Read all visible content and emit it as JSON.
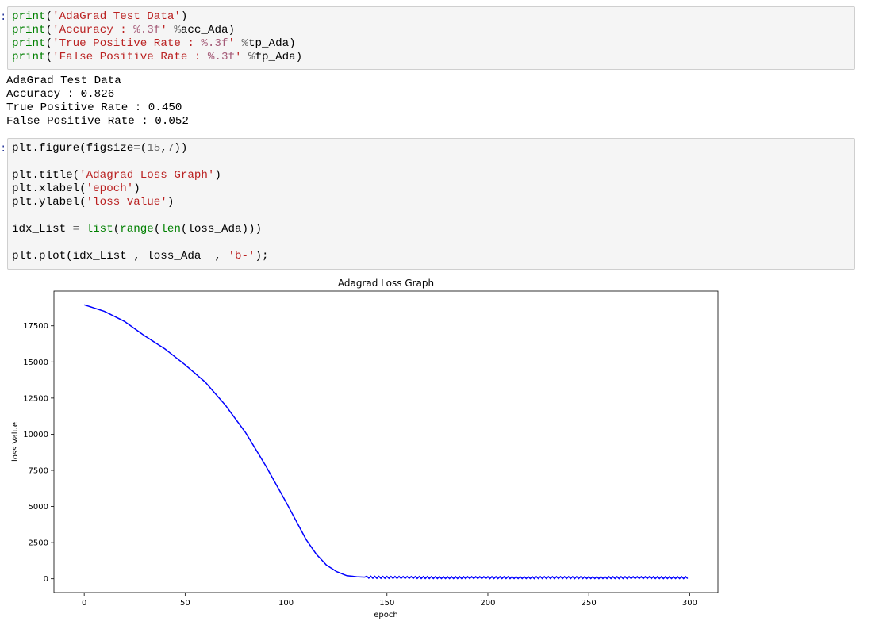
{
  "cell1": {
    "lines": [
      [
        {
          "t": "print",
          "c": "kw"
        },
        {
          "t": "(",
          "c": ""
        },
        {
          "t": "'AdaGrad Test Data'",
          "c": "str"
        },
        {
          "t": ")",
          "c": ""
        }
      ],
      [
        {
          "t": "print",
          "c": "kw"
        },
        {
          "t": "(",
          "c": ""
        },
        {
          "t": "'Accuracy : ",
          "c": "str"
        },
        {
          "t": "%.3f",
          "c": "fmt"
        },
        {
          "t": "'",
          "c": "str"
        },
        {
          "t": " ",
          "c": ""
        },
        {
          "t": "%",
          "c": "op"
        },
        {
          "t": "acc_Ada)",
          "c": ""
        }
      ],
      [
        {
          "t": "print",
          "c": "kw"
        },
        {
          "t": "(",
          "c": ""
        },
        {
          "t": "'True Positive Rate : ",
          "c": "str"
        },
        {
          "t": "%.3f",
          "c": "fmt"
        },
        {
          "t": "'",
          "c": "str"
        },
        {
          "t": " ",
          "c": ""
        },
        {
          "t": "%",
          "c": "op"
        },
        {
          "t": "tp_Ada)",
          "c": ""
        }
      ],
      [
        {
          "t": "print",
          "c": "kw"
        },
        {
          "t": "(",
          "c": ""
        },
        {
          "t": "'False Positive Rate : ",
          "c": "str"
        },
        {
          "t": "%.3f",
          "c": "fmt"
        },
        {
          "t": "'",
          "c": "str"
        },
        {
          "t": " ",
          "c": ""
        },
        {
          "t": "%",
          "c": "op"
        },
        {
          "t": "fp_Ada)",
          "c": ""
        }
      ]
    ]
  },
  "output1": {
    "lines": [
      "AdaGrad Test Data",
      "Accuracy : 0.826",
      "True Positive Rate : 0.450",
      "False Positive Rate : 0.052"
    ]
  },
  "cell2": {
    "lines": [
      [
        {
          "t": "plt.figure(figsize",
          "c": ""
        },
        {
          "t": "=",
          "c": "op"
        },
        {
          "t": "(",
          "c": ""
        },
        {
          "t": "15",
          "c": "num"
        },
        {
          "t": ",",
          "c": ""
        },
        {
          "t": "7",
          "c": "num"
        },
        {
          "t": "))",
          "c": ""
        }
      ],
      [],
      [
        {
          "t": "plt.title(",
          "c": ""
        },
        {
          "t": "'Adagrad Loss Graph'",
          "c": "str"
        },
        {
          "t": ")",
          "c": ""
        }
      ],
      [
        {
          "t": "plt.xlabel(",
          "c": ""
        },
        {
          "t": "'epoch'",
          "c": "str"
        },
        {
          "t": ")",
          "c": ""
        }
      ],
      [
        {
          "t": "plt.ylabel(",
          "c": ""
        },
        {
          "t": "'loss Value'",
          "c": "str"
        },
        {
          "t": ")",
          "c": ""
        }
      ],
      [],
      [
        {
          "t": "idx_List ",
          "c": ""
        },
        {
          "t": "=",
          "c": "op"
        },
        {
          "t": " ",
          "c": ""
        },
        {
          "t": "list",
          "c": "kw"
        },
        {
          "t": "(",
          "c": ""
        },
        {
          "t": "range",
          "c": "kw"
        },
        {
          "t": "(",
          "c": ""
        },
        {
          "t": "len",
          "c": "kw"
        },
        {
          "t": "(loss_Ada)))",
          "c": ""
        }
      ],
      [],
      [
        {
          "t": "plt.plot(idx_List , loss_Ada  , ",
          "c": ""
        },
        {
          "t": "'b-'",
          "c": "str"
        },
        {
          "t": ");",
          "c": ""
        }
      ]
    ]
  },
  "chart_data": {
    "type": "line",
    "title": "Adagrad Loss Graph",
    "xlabel": "epoch",
    "ylabel": "loss Value",
    "xlim": [
      -15,
      314
    ],
    "ylim": [
      -950,
      19900
    ],
    "xticks": [
      0,
      50,
      100,
      150,
      200,
      250,
      300
    ],
    "yticks": [
      0,
      2500,
      5000,
      7500,
      10000,
      12500,
      15000,
      17500
    ],
    "color": "#0000ff",
    "series": [
      {
        "x": [
          0,
          10,
          20,
          30,
          40,
          50,
          60,
          70,
          80,
          90,
          100,
          105,
          110,
          115,
          120,
          125,
          130,
          135,
          140,
          145,
          150,
          160,
          170,
          180,
          190,
          200,
          210,
          220,
          230,
          240,
          250,
          260,
          270,
          280,
          290,
          299
        ],
        "values": [
          18950,
          18500,
          17800,
          16800,
          15900,
          14800,
          13600,
          12000,
          10100,
          7800,
          5300,
          4000,
          2700,
          1700,
          950,
          500,
          220,
          140,
          110,
          100,
          95,
          90,
          85,
          80,
          80,
          80,
          80,
          80,
          80,
          80,
          80,
          80,
          80,
          80,
          80,
          80
        ],
        "noise_start": 140,
        "noise_amp": 70
      }
    ]
  }
}
